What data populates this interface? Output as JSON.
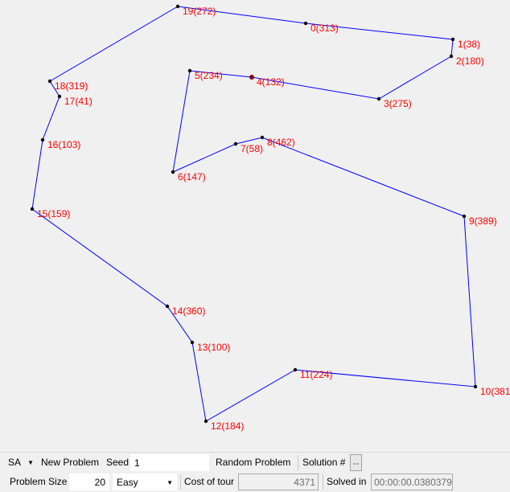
{
  "nodes": [
    {
      "label": "0(313)"
    },
    {
      "label": "1(38)"
    },
    {
      "label": "2(180)"
    },
    {
      "label": "3(275)"
    },
    {
      "label": "4(132)"
    },
    {
      "label": "5(234)"
    },
    {
      "label": "6(147)"
    },
    {
      "label": "7(58)"
    },
    {
      "label": "8(462)"
    },
    {
      "label": "9(389)"
    },
    {
      "label": "10(381"
    },
    {
      "label": "11(224)"
    },
    {
      "label": "12(184)"
    },
    {
      "label": "13(100)"
    },
    {
      "label": "14(360)"
    },
    {
      "label": "15(159)"
    },
    {
      "label": "16(103)"
    },
    {
      "label": "17(41)"
    },
    {
      "label": "18(319)"
    },
    {
      "label": "19(272)"
    }
  ],
  "tour_order": [
    19,
    0,
    1,
    2,
    3,
    4,
    5,
    6,
    7,
    8,
    9,
    10,
    11,
    12,
    13,
    14,
    15,
    16,
    17,
    18
  ],
  "colors": {
    "edge": "#0000ff",
    "label": "#ff0000",
    "node": "#000000",
    "start_node": "#8b0000"
  },
  "toolbar_top": {
    "algorithm": "SA",
    "new_problem": "New Problem",
    "seed_label": "Seed",
    "seed_value": "1",
    "random_problem": "Random Problem",
    "solution_label": "Solution #",
    "solution_button": "--"
  },
  "toolbar_bottom": {
    "problem_size_label": "Problem Size",
    "problem_size_value": "20",
    "difficulty": "Easy",
    "cost_label": "Cost of tour",
    "cost_value": "4371",
    "solved_label": "Solved in",
    "solved_value": "00:00:00.0380379"
  }
}
